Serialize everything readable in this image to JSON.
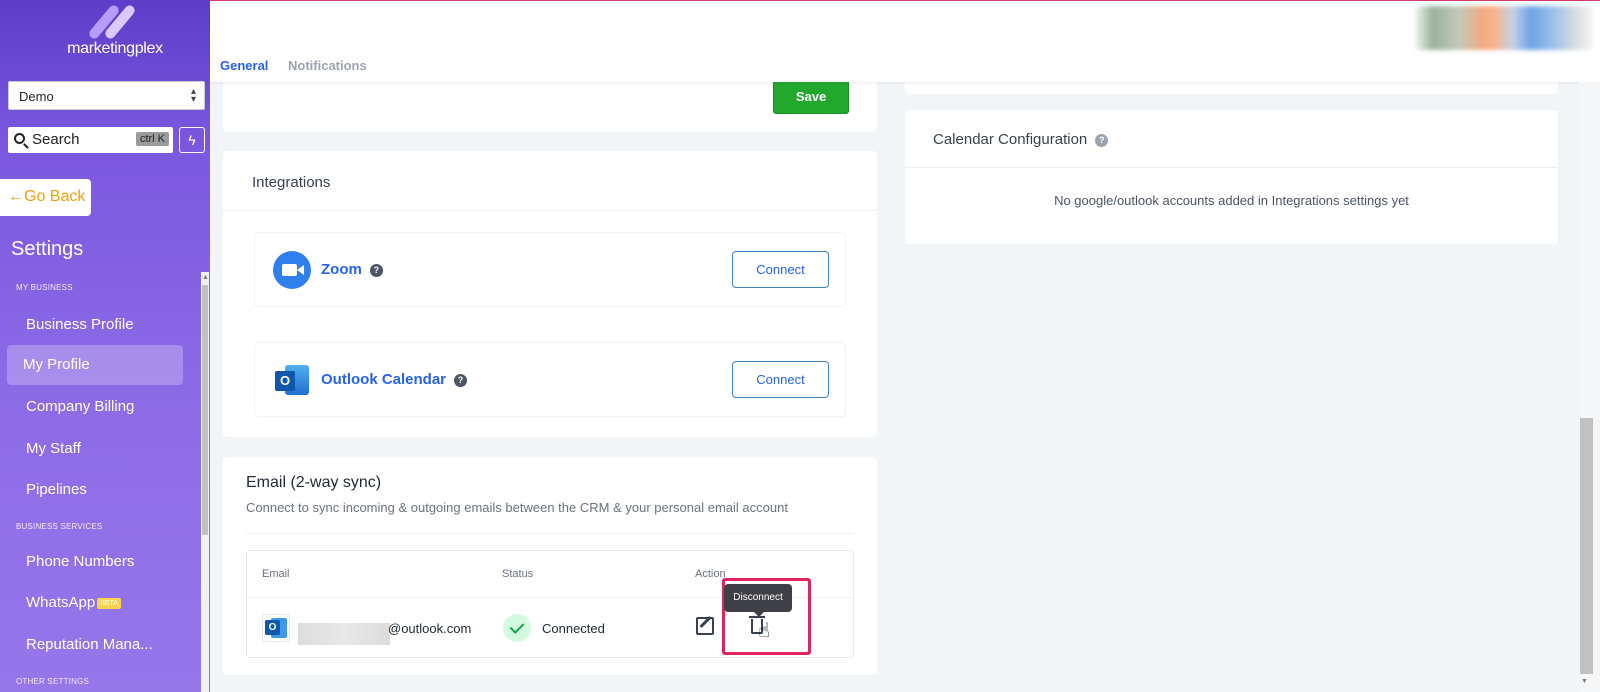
{
  "brand": {
    "name": "marketingplex"
  },
  "sidebar": {
    "account": "Demo",
    "search_placeholder": "Search",
    "search_shortcut": "ctrl K",
    "go_back": "Go Back",
    "title": "Settings",
    "sections": [
      {
        "label": "MY BUSINESS"
      },
      {
        "label": "BUSINESS SERVICES"
      },
      {
        "label": "OTHER SETTINGS"
      }
    ],
    "items": [
      {
        "label": "Business Profile"
      },
      {
        "label": "My Profile",
        "active": true
      },
      {
        "label": "Company Billing"
      },
      {
        "label": "My Staff"
      },
      {
        "label": "Pipelines"
      },
      {
        "label": "Phone Numbers"
      },
      {
        "label": "WhatsApp",
        "badge": "BETA"
      },
      {
        "label": "Reputation Mana..."
      }
    ]
  },
  "header": {
    "tabs": [
      {
        "label": "General",
        "active": true
      },
      {
        "label": "Notifications",
        "active": false
      }
    ]
  },
  "profile": {
    "save_label": "Save"
  },
  "integrations": {
    "title": "Integrations",
    "items": [
      {
        "name": "Zoom",
        "icon": "zoom-icon",
        "action": "Connect"
      },
      {
        "name": "Outlook Calendar",
        "icon": "outlook-icon",
        "action": "Connect"
      }
    ]
  },
  "email_sync": {
    "title": "Email (2-way sync)",
    "subtitle": "Connect to sync incoming & outgoing emails between the CRM & your personal email account",
    "columns": [
      "Email",
      "Status",
      "Action"
    ],
    "rows": [
      {
        "email_domain": "@outlook.com",
        "status": "Connected"
      }
    ],
    "tooltip": "Disconnect"
  },
  "calendar": {
    "title": "Calendar Configuration",
    "empty_message": "No google/outlook accounts added in Integrations settings yet"
  },
  "colors": {
    "accent": "#2563eb",
    "save": "#22a92d",
    "sidebar": "#8c6ae6",
    "highlight": "#e0245e",
    "go_back": "#f59e0b"
  }
}
